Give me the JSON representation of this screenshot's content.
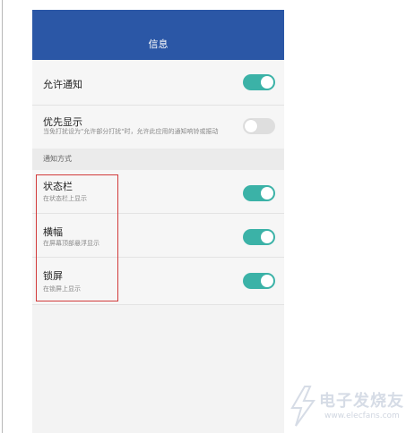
{
  "header": {
    "title": "信息"
  },
  "settings": {
    "allow_notifications": {
      "label": "允许通知",
      "enabled": true
    },
    "priority_display": {
      "label": "优先显示",
      "description": "当免打扰设为\"允许部分打扰\"时，允许此应用的通知响铃或振动",
      "enabled": false
    },
    "section_title": "通知方式",
    "status_bar": {
      "label": "状态栏",
      "description": "在状态栏上显示",
      "enabled": true
    },
    "banner": {
      "label": "横幅",
      "description": "在屏幕顶部悬浮显示",
      "enabled": true
    },
    "lock_screen": {
      "label": "锁屏",
      "description": "在锁屏上显示",
      "enabled": true
    }
  },
  "watermark": {
    "text_cn": "电子发烧友",
    "text_en": "www.elecfans.com"
  },
  "colors": {
    "header": "#2b57a6",
    "toggle_on": "#3bb2a7",
    "toggle_off": "#dedede",
    "highlight": "#d23b3b"
  }
}
